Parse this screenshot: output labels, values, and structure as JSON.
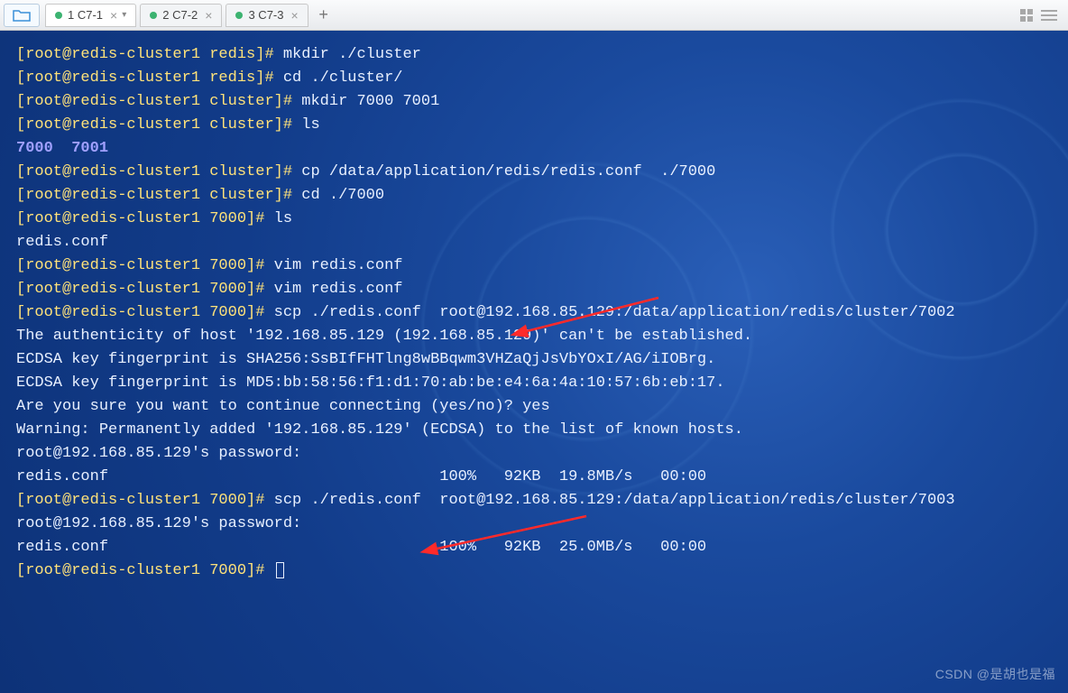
{
  "tabs": [
    {
      "label": "1 C7-1",
      "active": true
    },
    {
      "label": "2 C7-2",
      "active": false
    },
    {
      "label": "3 C7-3",
      "active": false
    }
  ],
  "add_tab": "+",
  "close_glyph": "×",
  "dropdown_glyph": "▾",
  "terminal": {
    "lines": [
      {
        "prompt": "[root@redis-cluster1 redis]# ",
        "cmd": "mkdir ./cluster"
      },
      {
        "prompt": "[root@redis-cluster1 redis]# ",
        "cmd": "cd ./cluster/"
      },
      {
        "prompt": "[root@redis-cluster1 cluster]# ",
        "cmd": "mkdir 7000 7001"
      },
      {
        "prompt": "[root@redis-cluster1 cluster]# ",
        "cmd": "ls"
      },
      {
        "dir": "7000  7001"
      },
      {
        "prompt": "[root@redis-cluster1 cluster]# ",
        "cmd": "cp /data/application/redis/redis.conf  ./7000"
      },
      {
        "prompt": "[root@redis-cluster1 cluster]# ",
        "cmd": "cd ./7000"
      },
      {
        "prompt": "[root@redis-cluster1 7000]# ",
        "cmd": "ls"
      },
      {
        "out": "redis.conf"
      },
      {
        "prompt": "[root@redis-cluster1 7000]# ",
        "cmd": "vim redis.conf"
      },
      {
        "prompt": "[root@redis-cluster1 7000]# ",
        "cmd": "vim redis.conf"
      },
      {
        "prompt": "[root@redis-cluster1 7000]# ",
        "cmd": "scp ./redis.conf  root@192.168.85.129:/data/application/redis/cluster/7002"
      },
      {
        "out": "The authenticity of host '192.168.85.129 (192.168.85.129)' can't be established."
      },
      {
        "out": "ECDSA key fingerprint is SHA256:SsBIfFHTlng8wBBqwm3VHZaQjJsVbYOxI/AG/iIOBrg."
      },
      {
        "out": "ECDSA key fingerprint is MD5:bb:58:56:f1:d1:70:ab:be:e4:6a:4a:10:57:6b:eb:17."
      },
      {
        "out": "Are you sure you want to continue connecting (yes/no)? yes"
      },
      {
        "out": "Warning: Permanently added '192.168.85.129' (ECDSA) to the list of known hosts."
      },
      {
        "out": "root@192.168.85.129's password: "
      },
      {
        "out": "redis.conf                                    100%   92KB  19.8MB/s   00:00    "
      },
      {
        "prompt": "[root@redis-cluster1 7000]# ",
        "cmd": "scp ./redis.conf  root@192.168.85.129:/data/application/redis/cluster/7003"
      },
      {
        "out": "root@192.168.85.129's password: "
      },
      {
        "out": "redis.conf                                    100%   92KB  25.0MB/s   00:00    "
      },
      {
        "prompt": "[root@redis-cluster1 7000]# ",
        "cursor": true
      }
    ]
  },
  "watermark": "CSDN @是胡也是福"
}
